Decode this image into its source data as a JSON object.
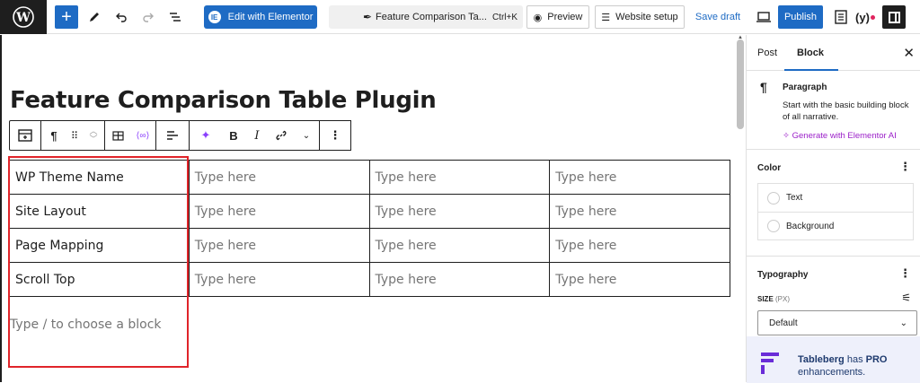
{
  "topbar": {
    "elementor_label": "Edit with Elementor",
    "document_title": "Feature Comparison Ta...",
    "shortcut": "Ctrl+K",
    "preview_label": "Preview",
    "setup_label": "Website setup",
    "save_draft_label": "Save draft",
    "publish_label": "Publish",
    "icons": [
      "wordpress-logo-icon",
      "plus-icon",
      "pencil-icon",
      "undo-icon",
      "redo-icon",
      "list-view-icon",
      "eye-icon",
      "device-preview-icon",
      "document-icon",
      "yoast-icon",
      "settings-panel-icon"
    ]
  },
  "editor": {
    "post_title": "Feature Comparison Table Plugin",
    "toolbar_icons": [
      "table-icon",
      "paragraph-icon",
      "drag-handle-icon",
      "move-up-down-icon",
      "table-edit-icon",
      "link-block-icon",
      "align-icon",
      "ai-sparkle-icon",
      "bold-icon",
      "italic-icon",
      "link-icon",
      "more-options-chevron-icon",
      "more-vertical-icon"
    ],
    "table": {
      "rows": [
        [
          "WP Theme Name",
          "Type here",
          "Type here",
          "Type here"
        ],
        [
          "Site Layout",
          "Type here",
          "Type here",
          "Type here"
        ],
        [
          "Page Mapping",
          "Type here",
          "Type here",
          "Type here"
        ],
        [
          "Scroll Top",
          "Type here",
          "Type here",
          "Type here"
        ]
      ]
    },
    "block_placeholder": "Type / to choose a block"
  },
  "sidebar": {
    "tabs": [
      "Post",
      "Block"
    ],
    "active_tab": "Block",
    "block_card": {
      "name": "Paragraph",
      "description": "Start with the basic building block of all narrative.",
      "ai_link": "Generate with Elementor AI"
    },
    "color": {
      "title": "Color",
      "items": [
        "Text",
        "Background"
      ]
    },
    "typography": {
      "title": "Typography",
      "size_label": "SIZE",
      "size_unit": "(PX)",
      "size_value": "Default"
    },
    "promo": {
      "brand": "Tableberg",
      "text_mid": "has",
      "pro": "PRO",
      "text_end": "enhancements."
    }
  },
  "colors": {
    "accent": "#1e6bc4",
    "highlight": "#e0242a",
    "ai_purple": "#9b1fc9",
    "promo_bg": "#eef0fb"
  }
}
